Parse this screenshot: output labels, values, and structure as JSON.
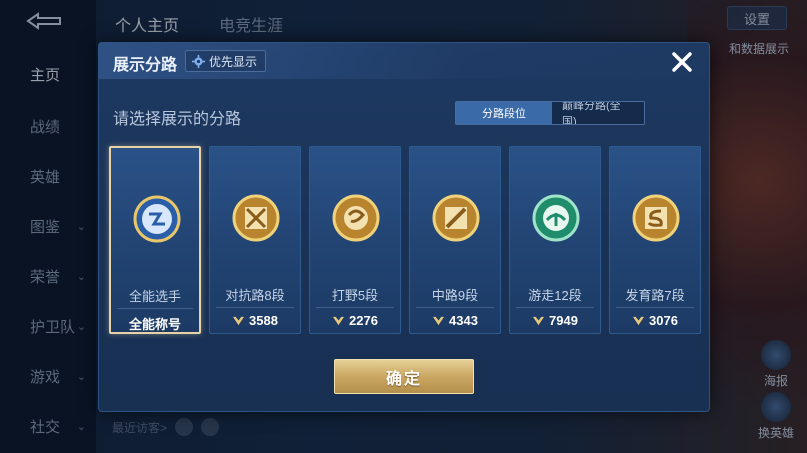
{
  "background": {
    "nav_items": [
      {
        "label": "主页",
        "has_chevron": false,
        "active": true
      },
      {
        "label": "战绩",
        "has_chevron": false
      },
      {
        "label": "英雄",
        "has_chevron": false
      },
      {
        "label": "图鉴",
        "has_chevron": true
      },
      {
        "label": "荣誉",
        "has_chevron": true
      },
      {
        "label": "护卫队",
        "has_chevron": true
      },
      {
        "label": "游戏",
        "has_chevron": true
      },
      {
        "label": "社交",
        "has_chevron": true
      }
    ],
    "top_tabs": [
      "个人主页",
      "电竞生涯"
    ],
    "settings_label": "设置",
    "data_show_label": "和数据展示",
    "recent_visitors_label": "最近访客>",
    "right_actions": [
      "海报",
      "换英雄"
    ]
  },
  "modal": {
    "title": "展示分路",
    "priority_button": "优先显示",
    "subtitle": "请选择展示的分路",
    "toggle": {
      "left": "分路段位",
      "right": "巅峰分路(全国)",
      "selected": "left"
    },
    "cards": [
      {
        "label": "全能选手",
        "score": "全能称号",
        "emblem": "all-round-emblem",
        "color": "#3d7fd6",
        "selected": true
      },
      {
        "label": "对抗路8段",
        "score": "3588",
        "emblem": "clash-lane-emblem",
        "color": "#d9a441"
      },
      {
        "label": "打野5段",
        "score": "2276",
        "emblem": "jungle-emblem",
        "color": "#d9a441"
      },
      {
        "label": "中路9段",
        "score": "4343",
        "emblem": "mid-lane-emblem",
        "color": "#d9a441"
      },
      {
        "label": "游走12段",
        "score": "7949",
        "emblem": "roam-emblem",
        "color": "#2fb58f"
      },
      {
        "label": "发育路7段",
        "score": "3076",
        "emblem": "farm-lane-emblem",
        "color": "#d9a441"
      }
    ],
    "confirm_label": "确定"
  }
}
